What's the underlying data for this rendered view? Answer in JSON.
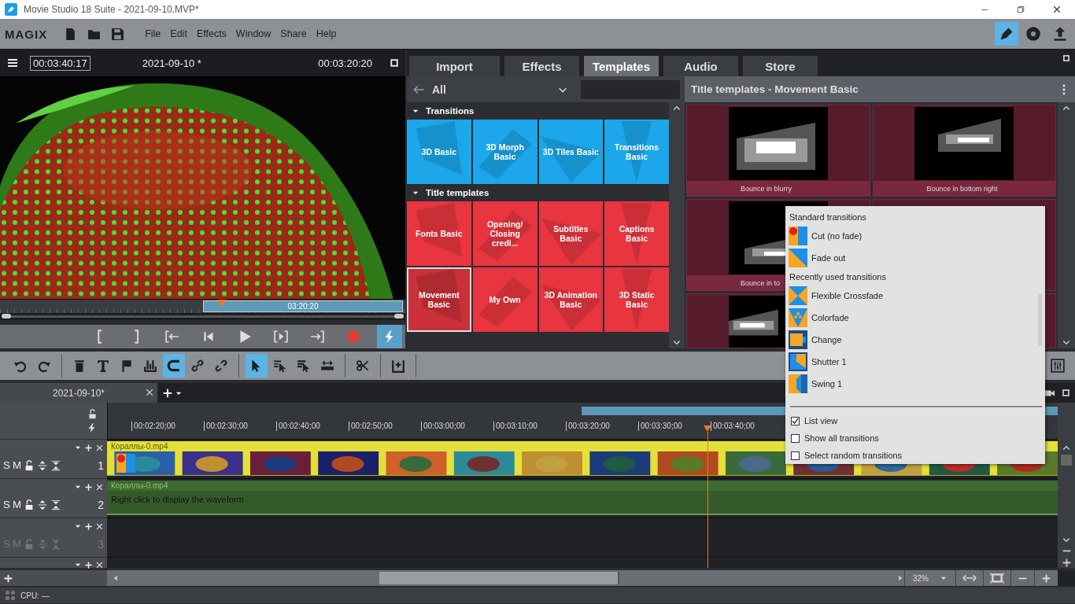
{
  "window": {
    "title": "Movie Studio 18 Suite - 2021-09-10.MVP*"
  },
  "menu": {
    "logo": "MAGIX",
    "files": [
      {
        "kind": "new"
      },
      {
        "kind": "open"
      },
      {
        "kind": "save"
      }
    ],
    "items": [
      "File",
      "Edit",
      "Effects",
      "Window",
      "Share",
      "Help"
    ],
    "tools": [
      {
        "kind": "pen",
        "selected": true
      },
      {
        "kind": "disc",
        "selected": false
      },
      {
        "kind": "upload",
        "selected": false
      }
    ]
  },
  "preview": {
    "position": "00:03:40:17",
    "project": "2021-09-10 *",
    "duration": "00:03:20:20",
    "range_label": "03:20:20",
    "transport": [
      {
        "kind": "set-in",
        "selected": false
      },
      {
        "kind": "set-out",
        "selected": false
      },
      {
        "kind": "go-in",
        "selected": false
      },
      {
        "kind": "prev",
        "selected": false
      },
      {
        "kind": "play",
        "selected": false
      },
      {
        "kind": "next",
        "selected": false
      },
      {
        "kind": "go-out",
        "selected": false
      },
      {
        "kind": "record",
        "selected": false
      },
      {
        "kind": "bolt",
        "selected": true
      }
    ]
  },
  "media_pool": {
    "tabs": [
      {
        "label": "Import",
        "selected": false
      },
      {
        "label": "Effects",
        "selected": false
      },
      {
        "label": "Templates",
        "selected": true
      },
      {
        "label": "Audio",
        "selected": false
      },
      {
        "label": "Store",
        "selected": false
      }
    ],
    "filter": "All",
    "panel_title": "Title templates - Movement Basic",
    "sections": [
      {
        "title": "Transitions",
        "kind": "transition",
        "tiles": [
          {
            "label": "3D Basic",
            "selected": false
          },
          {
            "label": "3D Morph Basic",
            "selected": false
          },
          {
            "label": "3D Tiles Basic",
            "selected": false
          },
          {
            "label": "Transitions Basic",
            "selected": false
          }
        ]
      },
      {
        "title": "Title templates",
        "kind": "title",
        "tiles": [
          {
            "label": "Fonts Basic",
            "selected": false
          },
          {
            "label": "Opening/ Closing credi...",
            "selected": false
          },
          {
            "label": "Subtitles Basic",
            "selected": false
          },
          {
            "label": "Captions Basic",
            "selected": false
          },
          {
            "label": "Movement Basic",
            "selected": true
          },
          {
            "label": "My Own",
            "selected": false
          },
          {
            "label": "3D Animation Basic",
            "selected": false
          },
          {
            "label": "3D Static Basic",
            "selected": false
          }
        ]
      }
    ],
    "templates": [
      {
        "kind": "template",
        "label": "Bounce in blurry"
      },
      {
        "kind": "template",
        "label": "Bounce in bottom right"
      },
      {
        "kind": "template",
        "label": "Bounce in to"
      },
      {
        "kind": "blank"
      },
      {
        "kind": "picture"
      },
      {
        "kind": "blank"
      }
    ]
  },
  "toolbar": {
    "groups": [
      [
        {
          "kind": "undo",
          "selected": false
        },
        {
          "kind": "redo",
          "selected": false
        }
      ],
      [
        {
          "kind": "trash",
          "selected": false
        },
        {
          "kind": "text",
          "selected": false
        },
        {
          "kind": "flag",
          "selected": false
        },
        {
          "kind": "split",
          "selected": false
        },
        {
          "kind": "magnet",
          "selected": true
        },
        {
          "kind": "link",
          "selected": false
        },
        {
          "kind": "unlink",
          "selected": false
        }
      ],
      [
        {
          "kind": "pointer",
          "selected": true
        },
        {
          "kind": "pointer-track",
          "selected": false
        },
        {
          "kind": "pointer-all",
          "selected": false
        },
        {
          "kind": "stretch",
          "selected": false
        }
      ],
      [
        {
          "kind": "scissors",
          "selected": false
        }
      ],
      [
        {
          "kind": "insert",
          "selected": false
        }
      ]
    ]
  },
  "timeline": {
    "tabs": [
      {
        "label": "2021-09-10*",
        "selected": true
      }
    ],
    "ruler": [
      "00:02:20;00",
      "00:02:30;00",
      "00:02:40;00",
      "00:02:50;00",
      "00:03:00;00",
      "00:03:10;00",
      "00:03:20;00",
      "00:03:30;00",
      "00:03:40;00"
    ],
    "tracks": [
      {
        "kind": "video",
        "number": "1",
        "solo": "S",
        "mute": "M",
        "disabled": false,
        "clip": "Кораллы-0.mp4"
      },
      {
        "kind": "audio",
        "number": "2",
        "solo": "S",
        "mute": "M",
        "disabled": false,
        "clip": "Кораллы-0.mp4",
        "hint": "Right click to display the waveform"
      },
      {
        "kind": "empty",
        "number": "3",
        "solo": "S",
        "mute": "M",
        "disabled": true
      },
      {
        "kind": "collapsed"
      }
    ],
    "zoom": "32%"
  },
  "context_menu": {
    "sections": [
      {
        "title": "Standard transitions",
        "items": [
          {
            "kind": "cut",
            "label": "Cut (no fade)"
          },
          {
            "kind": "fade",
            "label": "Fade out"
          }
        ]
      },
      {
        "title": "Recently used transitions",
        "items": [
          {
            "kind": "crossfade",
            "label": "Flexible Crossfade"
          },
          {
            "kind": "colorfade",
            "label": "Colorfade"
          },
          {
            "kind": "change",
            "label": "Change"
          },
          {
            "kind": "shutter",
            "label": "Shutter 1"
          },
          {
            "kind": "swing",
            "label": "Swing 1"
          }
        ]
      }
    ],
    "options": [
      {
        "label": "List view",
        "checked": true
      },
      {
        "label": "Show all transitions",
        "checked": false
      },
      {
        "label": "Select random transitions",
        "checked": false
      }
    ]
  },
  "status_bar": {
    "cpu": "CPU: —"
  }
}
